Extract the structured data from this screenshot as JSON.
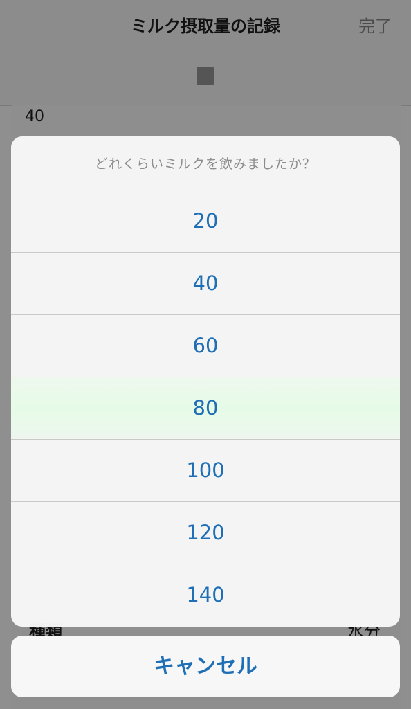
{
  "navbar": {
    "title": "ミルク摂取量の記録",
    "done_label": "完了",
    "stop_icon": "stop-icon"
  },
  "form": {
    "amount_value": "40",
    "kind_label": "種類",
    "kind_value": "水分"
  },
  "action_sheet": {
    "title": "どれくらいミルクを飲みましたか？",
    "options": [
      "20",
      "40",
      "60",
      "80",
      "100",
      "120",
      "140"
    ],
    "highlighted_option": "80",
    "cancel_label": "キャンセル"
  },
  "colors": {
    "accent": "#1f6fb6",
    "dim_background": "#8f8f8f",
    "sheet_background": "#f8f8f8"
  }
}
